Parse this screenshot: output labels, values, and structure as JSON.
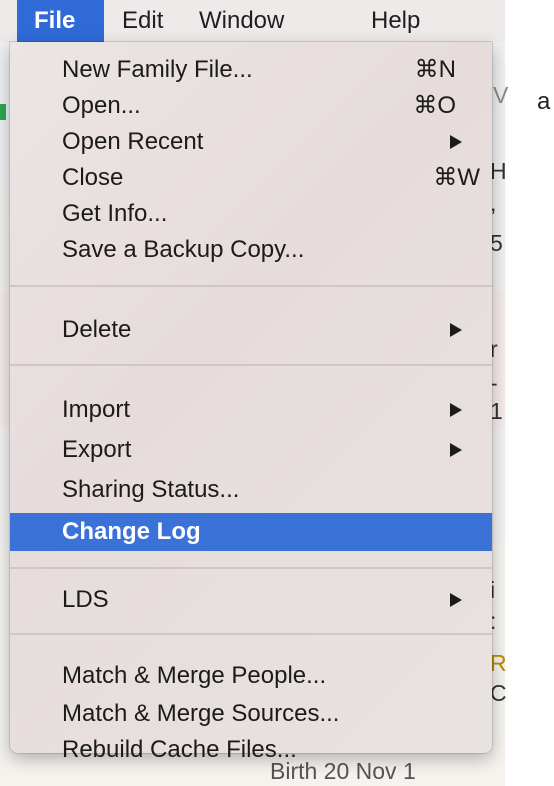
{
  "menubar": {
    "items": [
      "File",
      "Edit",
      "Window",
      "Help"
    ],
    "active": "File"
  },
  "outside_text": "a",
  "background_fragments": [
    "V",
    "H",
    ",",
    "5",
    "r",
    "-",
    "1",
    "i",
    ":",
    "R",
    "C",
    "Birth  20 Nov 1"
  ],
  "file_menu": {
    "new_family_file": {
      "label": "New Family File...",
      "shortcut": "⌘N"
    },
    "open": {
      "label": "Open...",
      "shortcut": "⌘O"
    },
    "open_recent": {
      "label": "Open Recent"
    },
    "close": {
      "label": "Close",
      "shortcut": "⌘W"
    },
    "get_info": {
      "label": "Get Info..."
    },
    "save_backup": {
      "label": "Save a Backup Copy..."
    },
    "delete": {
      "label": "Delete"
    },
    "import": {
      "label": "Import"
    },
    "export": {
      "label": "Export"
    },
    "sharing_status": {
      "label": "Sharing Status..."
    },
    "change_log": {
      "label": "Change Log"
    },
    "lds": {
      "label": "LDS"
    },
    "match_merge_people": {
      "label": "Match & Merge People..."
    },
    "match_merge_sources": {
      "label": "Match & Merge Sources..."
    },
    "rebuild_cache": {
      "label": "Rebuild Cache Files..."
    }
  },
  "colors": {
    "menubar_active": "#2f6ad6",
    "menu_highlight": "#3a72d8",
    "menu_background": "#e8e0df"
  }
}
